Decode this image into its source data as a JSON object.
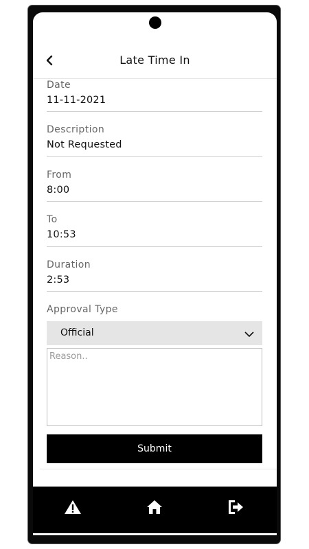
{
  "header": {
    "title": "Late Time In",
    "back_icon": "chevron-left-icon"
  },
  "fields": [
    {
      "label": "Date",
      "value": "11-11-2021"
    },
    {
      "label": "Description",
      "value": "Not Requested"
    },
    {
      "label": "From",
      "value": "8:00"
    },
    {
      "label": "To",
      "value": "10:53"
    },
    {
      "label": "Duration",
      "value": "2:53"
    }
  ],
  "approval": {
    "label": "Approval Type",
    "selected": "Official",
    "icon": "chevron-down-icon"
  },
  "reason": {
    "placeholder": "Reason..",
    "value": ""
  },
  "submit_label": "Submit",
  "nav": {
    "items": [
      {
        "icon": "warning-icon"
      },
      {
        "icon": "home-icon"
      },
      {
        "icon": "logout-icon"
      }
    ]
  },
  "colors": {
    "accent": "#000000",
    "select_bg": "#e5e5e5",
    "label": "#666666"
  }
}
